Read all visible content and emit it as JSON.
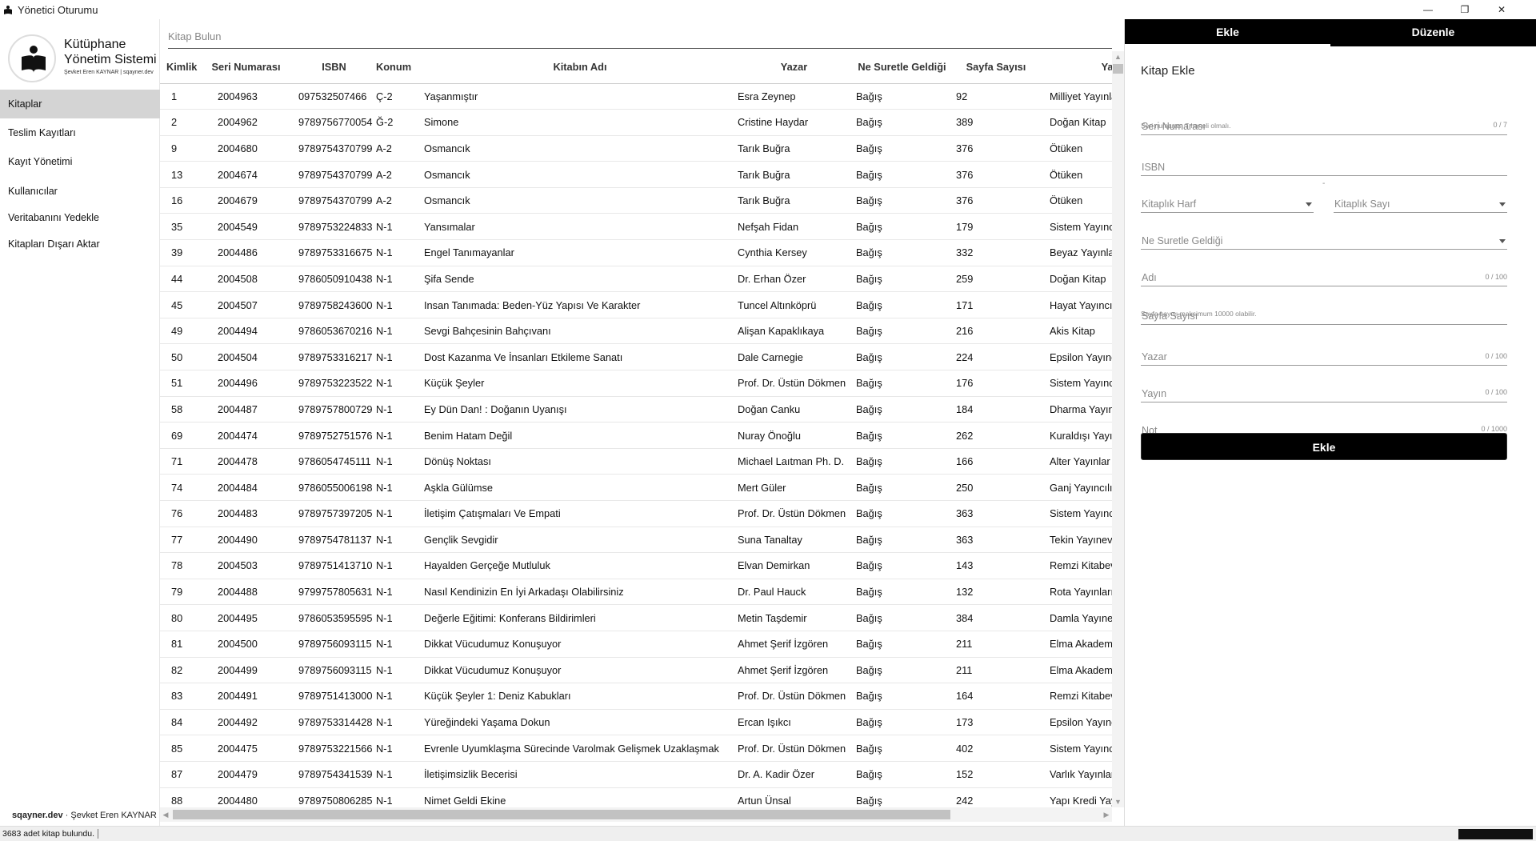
{
  "window": {
    "title": "Yönetici Oturumu",
    "min": "—",
    "restore": "❐",
    "close": "✕"
  },
  "logo": {
    "title": "Kütüphane Yönetim Sistemi",
    "subtitle": "Şevket Eren KAYNAR | sqayner.dev"
  },
  "sidebar": {
    "items": [
      {
        "label": "Kitaplar"
      },
      {
        "label": "Teslim Kayıtları"
      },
      {
        "label": "Kayıt Yönetimi"
      },
      {
        "label": "Kullanıcılar"
      },
      {
        "label": "Veritabanını Yedekle"
      },
      {
        "label": "Kitapları Dışarı Aktar"
      }
    ],
    "footer_bold": "sqayner.dev",
    "footer_rest": " · Şevket Eren KAYNAR"
  },
  "search": {
    "placeholder": "Kitap Bulun"
  },
  "table": {
    "headers": [
      "Kimlik",
      "Seri Numarası",
      "ISBN",
      "Konum",
      "Kitabın Adı",
      "Yazar",
      "Ne Suretle Geldiği",
      "Sayfa Sayısı",
      "Yayın"
    ],
    "rows": [
      [
        "1",
        "2004963",
        "097532507466",
        "Ç-2",
        "Yaşanmıştır",
        "Esra Zeynep",
        "Bağış",
        "92",
        "Milliyet Yayınları"
      ],
      [
        "2",
        "2004962",
        "9789756770054",
        "Ğ-2",
        "Simone",
        "Cristine Haydar",
        "Bağış",
        "389",
        "Doğan Kitap"
      ],
      [
        "9",
        "2004680",
        "9789754370799",
        "A-2",
        "Osmancık",
        "Tarık Buğra",
        "Bağış",
        "376",
        "Ötüken"
      ],
      [
        "13",
        "2004674",
        "9789754370799",
        "A-2",
        "Osmancık",
        "Tarık Buğra",
        "Bağış",
        "376",
        "Ötüken"
      ],
      [
        "16",
        "2004679",
        "9789754370799",
        "A-2",
        "Osmancık",
        "Tarık Buğra",
        "Bağış",
        "376",
        "Ötüken"
      ],
      [
        "35",
        "2004549",
        "9789753224833",
        "N-1",
        "Yansımalar",
        "Nefşah Fidan",
        "Bağış",
        "179",
        "Sistem Yayıncılık"
      ],
      [
        "39",
        "2004486",
        "9789753316675",
        "N-1",
        "Engel Tanımayanlar",
        "Cynthia Kersey",
        "Bağış",
        "332",
        "Beyaz Yayınları"
      ],
      [
        "44",
        "2004508",
        "9786050910438",
        "N-1",
        "Şifa Sende",
        "Dr. Erhan Özer",
        "Bağış",
        "259",
        "Doğan Kitap"
      ],
      [
        "45",
        "2004507",
        "9789758243600",
        "N-1",
        "Insan Tanımada: Beden-Yüz Yapısı Ve Karakter",
        "Tuncel Altınköprü",
        "Bağış",
        "171",
        "Hayat Yayıncılık"
      ],
      [
        "49",
        "2004494",
        "9786053670216",
        "N-1",
        "Sevgi Bahçesinin Bahçıvanı",
        "Alişan Kapaklıkaya",
        "Bağış",
        "216",
        "Akis Kitap"
      ],
      [
        "50",
        "2004504",
        "9789753316217",
        "N-1",
        "Dost Kazanma Ve İnsanları Etkileme Sanatı",
        "Dale Carnegie",
        "Bağış",
        "224",
        "Epsilon Yayıncılık"
      ],
      [
        "51",
        "2004496",
        "9789753223522",
        "N-1",
        "Küçük Şeyler",
        "Prof. Dr. Üstün Dökmen",
        "Bağış",
        "176",
        "Sistem Yayıncılık"
      ],
      [
        "58",
        "2004487",
        "9789757800729",
        "N-1",
        "Ey Dün Dan! : Doğanın Uyanışı",
        "Doğan Canku",
        "Bağış",
        "184",
        "Dharma Yayınları"
      ],
      [
        "69",
        "2004474",
        "9789752751576",
        "N-1",
        "Benim Hatam Değil",
        "Nuray Önoğlu",
        "Bağış",
        "262",
        "Kuraldışı Yayıncılık"
      ],
      [
        "71",
        "2004478",
        "9786054745111",
        "N-1",
        "Dönüş Noktası",
        "Michael Laıtman Ph. D.",
        "Bağış",
        "166",
        "Alter Yayınlar"
      ],
      [
        "74",
        "2004484",
        "9786055006198",
        "N-1",
        "Aşkla Gülümse",
        "Mert Güler",
        "Bağış",
        "250",
        "Ganj Yayıncılık"
      ],
      [
        "76",
        "2004483",
        "9789757397205",
        "N-1",
        "İletişim Çatışmaları Ve Empati",
        "Prof. Dr. Üstün Dökmen",
        "Bağış",
        "363",
        "Sistem Yayıncılık"
      ],
      [
        "77",
        "2004490",
        "9789754781137",
        "N-1",
        "Gençlik Sevgidir",
        "Suna Tanaltay",
        "Bağış",
        "363",
        "Tekin Yayınevi"
      ],
      [
        "78",
        "2004503",
        "9789751413710",
        "N-1",
        "Hayalden Gerçeğe Mutluluk",
        "Elvan Demirkan",
        "Bağış",
        "143",
        "Remzi Kitabevi"
      ],
      [
        "79",
        "2004488",
        "9799757805631",
        "N-1",
        "Nasıl Kendinizin En İyi Arkadaşı Olabilirsiniz",
        "Dr. Paul Hauck",
        "Bağış",
        "132",
        "Rota Yayınları"
      ],
      [
        "80",
        "2004495",
        "9786053595595",
        "N-1",
        "Değerle Eğitimi: Konferans Bildirimleri",
        "Metin Taşdemir",
        "Bağış",
        "384",
        "Damla Yayınevi"
      ],
      [
        "81",
        "2004500",
        "9789756093115",
        "N-1",
        "Dikkat Vücudumuz Konuşuyor",
        "Ahmet Şerif İzgören",
        "Bağış",
        "211",
        "Elma Akademi Art"
      ],
      [
        "82",
        "2004499",
        "9789756093115",
        "N-1",
        "Dikkat Vücudumuz Konuşuyor",
        "Ahmet Şerif İzgören",
        "Bağış",
        "211",
        "Elma Akademi Art"
      ],
      [
        "83",
        "2004491",
        "9789751413000",
        "N-1",
        "Küçük Şeyler 1: Deniz Kabukları",
        "Prof. Dr. Üstün Dökmen",
        "Bağış",
        "164",
        "Remzi Kitabevi"
      ],
      [
        "84",
        "2004492",
        "9789753314428",
        "N-1",
        "Yüreğindeki Yaşama Dokun",
        "Ercan Işıkcı",
        "Bağış",
        "173",
        "Epsilon Yayıncılık"
      ],
      [
        "85",
        "2004475",
        "9789753221566",
        "N-1",
        "Evrenle Uyumklaşma Sürecinde Varolmak Gelişmek Uzaklaşmak",
        "Prof. Dr. Üstün Dökmen",
        "Bağış",
        "402",
        "Sistem Yayıncılık"
      ],
      [
        "87",
        "2004479",
        "9789754341539",
        "N-1",
        "İletişimsizlik Becerisi",
        "Dr. A. Kadir Özer",
        "Bağış",
        "152",
        "Varlık Yayınları"
      ],
      [
        "88",
        "2004480",
        "9789750806285",
        "N-1",
        "Nimet Geldi Ekine",
        "Artun Ünsal",
        "Bağış",
        "242",
        "Yapı Kredi Yayınla"
      ]
    ]
  },
  "panel": {
    "tabs": [
      {
        "label": "Ekle"
      },
      {
        "label": "Düzenle"
      }
    ],
    "title": "Kitap Ekle",
    "fields": {
      "serial": {
        "placeholder": "Seri Numarası",
        "hint": "Seri numarası 7 haneli olmalı.",
        "counter": "0 / 7"
      },
      "isbn": {
        "placeholder": "ISBN"
      },
      "shelf_letter": {
        "placeholder": "Kitaplık Harf"
      },
      "shelf_number": {
        "placeholder": "Kitaplık Sayı"
      },
      "acquisition": {
        "placeholder": "Ne Suretle Geldiği"
      },
      "name": {
        "placeholder": "Adı",
        "counter": "0 / 100"
      },
      "pages": {
        "placeholder": "Sayfa Sayısı",
        "hint": "Sayfa sayısı maksimum 10000 olabilir."
      },
      "author": {
        "placeholder": "Yazar",
        "counter": "0 / 100"
      },
      "publisher": {
        "placeholder": "Yayın",
        "counter": "0 / 100"
      },
      "note": {
        "placeholder": "Not",
        "counter": "0 / 1000"
      }
    },
    "dash": "-",
    "submit_label": "Ekle"
  },
  "status": {
    "message": "3683 adet kitap bulundu."
  }
}
